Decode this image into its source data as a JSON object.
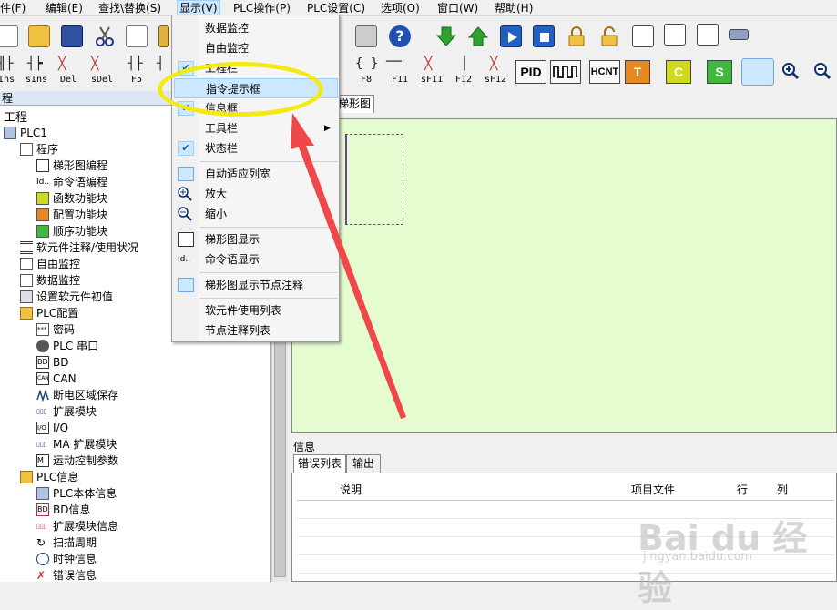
{
  "menubar": {
    "items": [
      "件(F)",
      "编辑(E)",
      "查找\\替换(S)",
      "显示(V)",
      "PLC操作(P)",
      "PLC设置(C)",
      "选项(O)",
      "窗口(W)",
      "帮助(H)"
    ]
  },
  "toolbar2": {
    "labels": [
      "Ins",
      "sIns",
      "Del",
      "sDel",
      "F5",
      "F8",
      "F11",
      "sF11",
      "F12",
      "sF12"
    ],
    "big_buttons": [
      "PID",
      "HCNT",
      "T",
      "C",
      "S"
    ]
  },
  "left_panel": {
    "title": "程",
    "tree": [
      "工程",
      "PLC1",
      "程序",
      "梯形图编程",
      "命令语编程",
      "函数功能块",
      "配置功能块",
      "顺序功能块",
      "软元件注释/使用状况",
      "自由监控",
      "数据监控",
      "设置软元件初值",
      "PLC配置",
      "密码",
      "PLC 串口",
      "BD",
      "CAN",
      "断电区域保存",
      "扩展模块",
      "I/O",
      "MA 扩展模块",
      "运动控制参数",
      "PLC信息",
      "PLC本体信息",
      "BD信息",
      "扩展模块信息",
      "扫描周期",
      "时钟信息",
      "错误信息"
    ]
  },
  "document": {
    "tab": "梯形图"
  },
  "info": {
    "header": "信息",
    "tabs": [
      "错误列表",
      "输出"
    ],
    "columns": [
      "说明",
      "项目文件",
      "行",
      "列"
    ]
  },
  "dropdown": {
    "items": [
      "数据监控",
      "自由监控",
      "工程栏",
      "指令提示框",
      "信息框",
      "工具栏",
      "状态栏",
      "自动适应列宽",
      "放大",
      "缩小",
      "梯形图显示",
      "命令语显示",
      "梯形图显示节点注释",
      "软元件使用列表",
      "节点注释列表"
    ]
  },
  "watermark": {
    "main": "Bai du 经验",
    "sub": "jingyan.baidu.com"
  },
  "colors": {
    "highlight": "#cce8ff",
    "ladder_bg": "#e4fcd0",
    "annotation": "#f2ea10",
    "arrow": "#f04848"
  }
}
